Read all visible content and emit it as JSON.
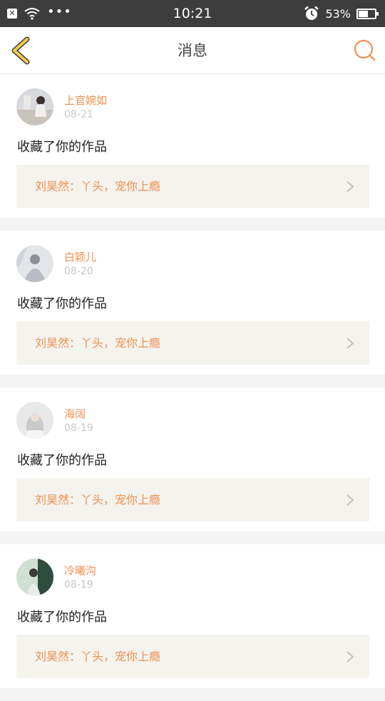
{
  "status_bar": {
    "time": "10:21",
    "battery_percent_text": "53%",
    "battery_level": 0.53,
    "dots": "•••"
  },
  "header": {
    "title": "消息"
  },
  "colors": {
    "accent": "#f0904f",
    "back_arrow": "#f2c94c",
    "date": "#c6c6c6",
    "quote_bg": "#f4f3ee"
  },
  "messages": [
    {
      "name": "上官婉如",
      "date": "08-21",
      "action": "收藏了你的作品",
      "quote": "刘昊然：丫头，宠你上瘾"
    },
    {
      "name": "白颖儿",
      "date": "08-20",
      "action": "收藏了你的作品",
      "quote": "刘昊然：丫头，宠你上瘾"
    },
    {
      "name": "海阔",
      "date": "08-19",
      "action": "收藏了你的作品",
      "quote": "刘昊然：丫头，宠你上瘾"
    },
    {
      "name": "冷曦沟",
      "date": "08-19",
      "action": "收藏了你的作品",
      "quote": "刘昊然：丫头，宠你上瘾"
    }
  ]
}
